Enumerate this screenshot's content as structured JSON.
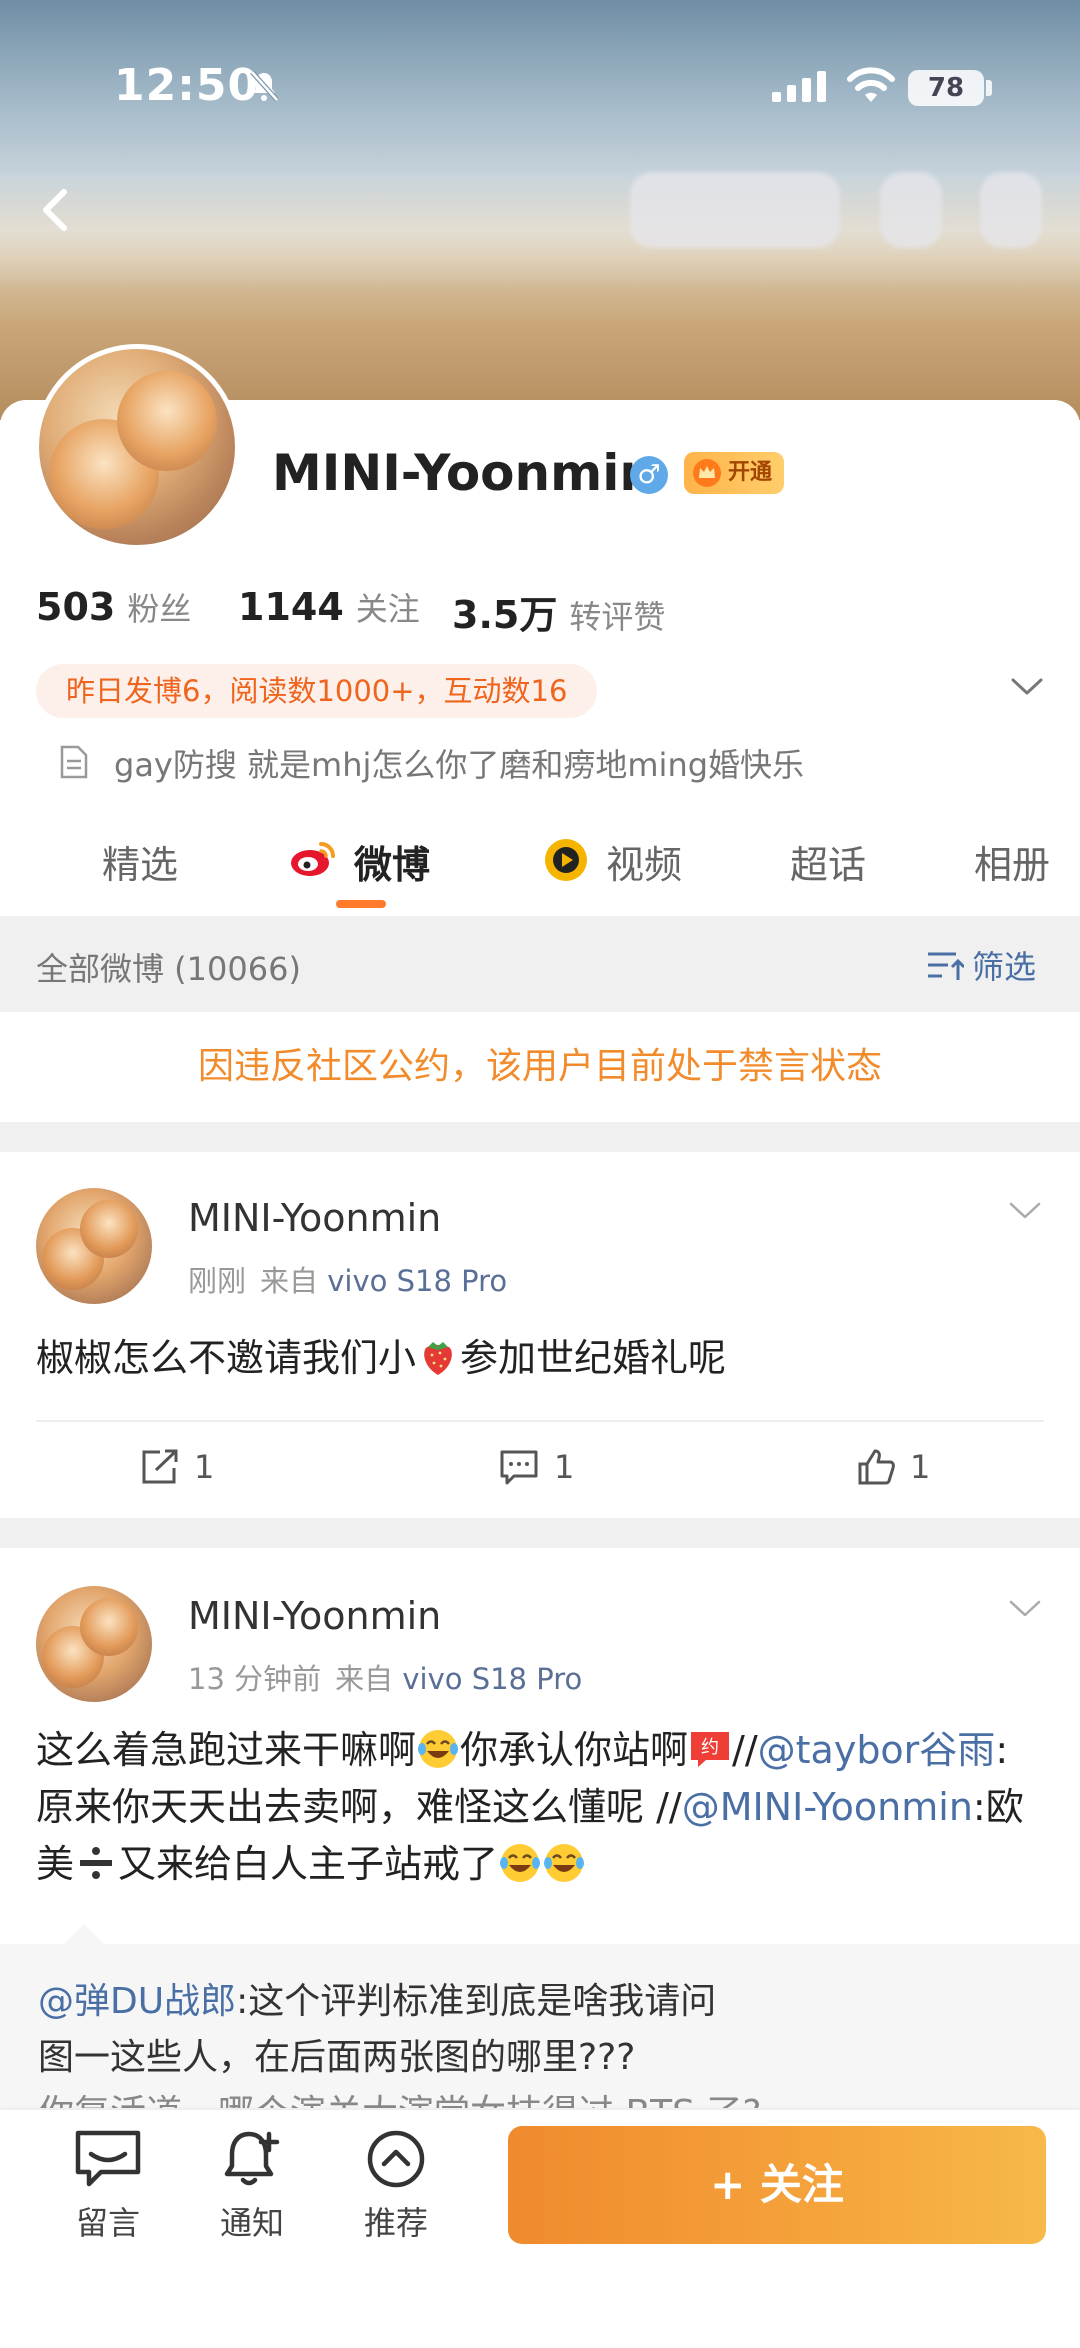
{
  "status_bar": {
    "time": "12:50",
    "battery": "78"
  },
  "profile": {
    "username": "MINI-Yoonmin",
    "gender_symbol": "♂",
    "vip_label": "开通",
    "stats": [
      {
        "value": "503",
        "label": "粉丝"
      },
      {
        "value": "1144",
        "label": "关注"
      },
      {
        "value": "3.5万",
        "label": "转评赞"
      }
    ],
    "activity": "昨日发博6，阅读数1000+，互动数16",
    "bio": "gay防搜 就是mhj怎么你了磨和痨地ming婚快乐"
  },
  "tabs": [
    {
      "label": "精选"
    },
    {
      "label": "微博"
    },
    {
      "label": "视频"
    },
    {
      "label": "超话"
    },
    {
      "label": "相册"
    }
  ],
  "feed_header": {
    "all_label": "全部微博 (10066)",
    "filter_label": "筛选"
  },
  "ban_notice": "因违反社区公约，该用户目前处于禁言状态",
  "posts": [
    {
      "author": "MINI-Yoonmin",
      "time": "刚刚",
      "source_prefix": "来自",
      "device": "vivo S18 Pro",
      "text_a": "椒椒怎么不邀请我们小",
      "emoji_a": "strawberry-emoji",
      "text_b": "参加世纪婚礼呢",
      "repost_count": "1",
      "comment_count": "1",
      "like_count": "1"
    },
    {
      "author": "MINI-Yoonmin",
      "time": "13 分钟前",
      "source_prefix": "来自",
      "device": "vivo S18 Pro",
      "seg1": "这么着急跑过来干嘛啊",
      "seg2": "你承认你站啊",
      "seg3": "//",
      "mention1": "@taybor谷雨",
      "seg4": ":原来你天天出去卖啊，难怪这么懂呢 //",
      "mention2": "@MINI-Yoonmin",
      "seg5": ":欧美",
      "seg6": "又来给白人主子站戒了",
      "quote_mention": "@弹DU战郎",
      "quote_text1": ":这个评判标准到底是啥我请问",
      "quote_text2": "图一这些人，在后面两张图的哪里???",
      "quote_text3": "你复活道，哪个演关大演堂女技得过 BTS 了?"
    }
  ],
  "bottom_bar": {
    "message_label": "留言",
    "notify_label": "通知",
    "recommend_label": "推荐",
    "follow_label": "+ 关注"
  },
  "colors": {
    "accent_orange": "#f5a03a",
    "link_blue": "#4a6fa5",
    "ban_orange": "#f28b2b",
    "activity_orange": "#f0651d"
  }
}
